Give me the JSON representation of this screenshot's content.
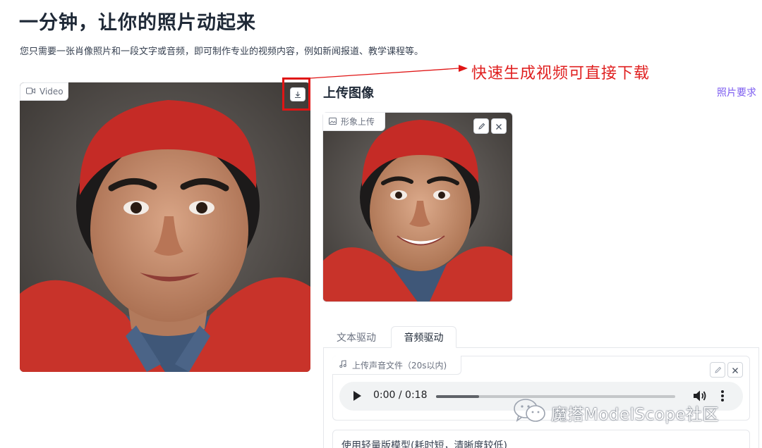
{
  "header": {
    "title": "一分钟，让你的照片动起来",
    "subtitle": "您只需要一张肖像照片和一段文字或音频，即可制作专业的视频内容，例如新闻报道、教学课程等。"
  },
  "annotation": {
    "text": "快速生成视频可直接下载",
    "color": "#e02020"
  },
  "video_panel": {
    "label": "Video",
    "label_icon": "video-camera-icon",
    "download_icon": "download-icon"
  },
  "upload": {
    "title": "上传图像",
    "requirements_link": "照片要求",
    "image_label": "形象上传",
    "image_label_icon": "image-icon",
    "edit_icon": "pencil-icon",
    "clear_icon": "close-icon"
  },
  "tabs": [
    {
      "label": "文本驱动",
      "active": false
    },
    {
      "label": "音频驱动",
      "active": true
    }
  ],
  "audio": {
    "label": "上传声音文件（20s以内)",
    "label_icon": "music-note-icon",
    "current_time": "0:00",
    "duration": "0:18",
    "time_display": "0:00 / 0:18",
    "progress": 0.18
  },
  "model_option": {
    "label": "使用轻量版模型(耗时短，清晰度较低)"
  },
  "watermark": {
    "text": "魔搭ModelScope社区",
    "icon": "wechat-icon"
  },
  "colors": {
    "accent": "#7c5cf0",
    "annotation_red": "#e01515",
    "jacket_red": "#c8332a"
  }
}
